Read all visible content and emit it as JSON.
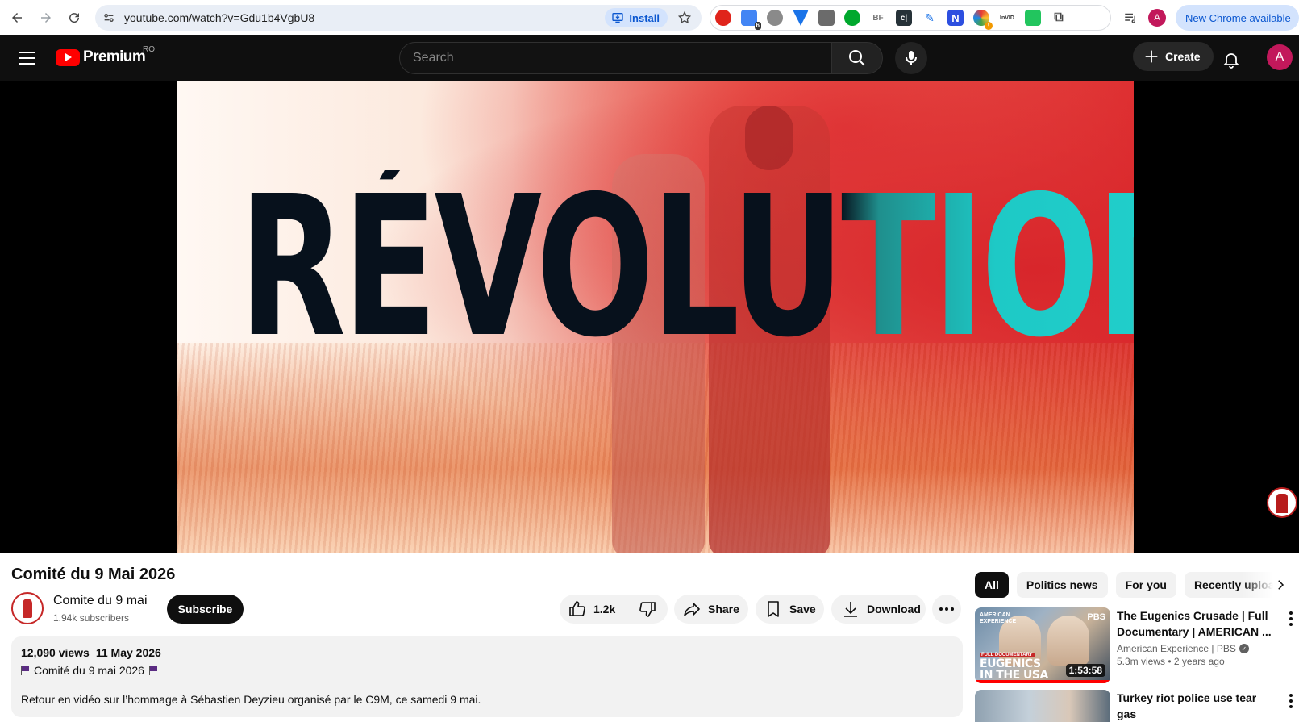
{
  "browser": {
    "url": "youtube.com/watch?v=Gdu1b4VgbU8",
    "install_label": "Install",
    "profile_initial": "A",
    "new_chrome_label": "New Chrome available",
    "extensions": [
      {
        "name": "opera-icon",
        "badge": ""
      },
      {
        "name": "extension-badge-icon",
        "badge": "6"
      },
      {
        "name": "robot-icon",
        "badge": ""
      },
      {
        "name": "vee-icon",
        "badge": ""
      },
      {
        "name": "building-icon",
        "badge": ""
      },
      {
        "name": "evernote-icon",
        "badge": ""
      },
      {
        "name": "bf-icon",
        "label": "BF"
      },
      {
        "name": "ci-icon",
        "label": "c|"
      },
      {
        "name": "feather-icon",
        "badge": ""
      },
      {
        "name": "n-icon",
        "label": "N"
      },
      {
        "name": "colorwheel-icon",
        "badge": "!"
      },
      {
        "name": "invid-icon",
        "label": "InVID"
      },
      {
        "name": "green-app-icon",
        "badge": ""
      },
      {
        "name": "puzzle-icon",
        "badge": ""
      }
    ]
  },
  "masthead": {
    "logo_text": "Premium",
    "country_code": "RO",
    "search_placeholder": "Search",
    "create_label": "Create",
    "avatar_initial": "A"
  },
  "video": {
    "overlay_title": "RÉVOLUTION",
    "title": "Comité du 9 Mai 2026",
    "channel_name": "Comite du 9 mai",
    "subscribers": "1.94k subscribers",
    "subscribe_label": "Subscribe",
    "likes": "1.2k",
    "share_label": "Share",
    "save_label": "Save",
    "download_label": "Download"
  },
  "description": {
    "views": "12,090 views",
    "date": "11 May 2026",
    "tag_line": "Comité du 9 mai 2026",
    "text": "Retour en vidéo sur l’hommage à Sébastien Deyzieu organisé par le C9M, ce samedi 9 mai."
  },
  "chips": [
    "All",
    "Politics news",
    "For you",
    "Recently uploaded"
  ],
  "recommendations": [
    {
      "title": "The Eugenics Crusade | Full Documentary | AMERICAN ...",
      "channel": "American Experience | PBS",
      "verified": true,
      "views": "5.3m views",
      "age": "2 years ago",
      "duration": "1:53:58",
      "thumb_brand_top": "AMERICAN EXPERIENCE",
      "thumb_pbs": "PBS",
      "thumb_ribbon": "FULL DOCUMENTARY",
      "thumb_headline": "EUGENICS IN THE USA"
    },
    {
      "title": "Turkey riot police use tear gas"
    }
  ]
}
